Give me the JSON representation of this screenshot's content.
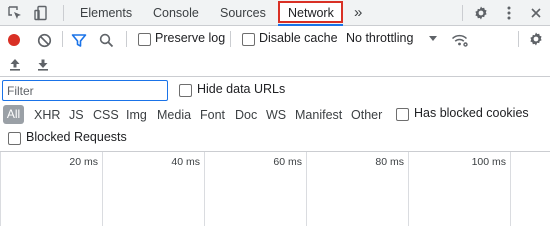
{
  "tabs": {
    "elements": "Elements",
    "console": "Console",
    "sources": "Sources",
    "network": "Network",
    "more": "»"
  },
  "toolbar": {
    "preserve_log": "Preserve log",
    "disable_cache": "Disable cache",
    "throttling": "No throttling"
  },
  "filter": {
    "value": "Filter",
    "hide_data_urls": "Hide data URLs"
  },
  "types": {
    "all": "All",
    "xhr": "XHR",
    "js": "JS",
    "css": "CSS",
    "img": "Img",
    "media": "Media",
    "font": "Font",
    "doc": "Doc",
    "ws": "WS",
    "manifest": "Manifest",
    "other": "Other",
    "has_blocked_cookies": "Has blocked cookies",
    "blocked_requests": "Blocked Requests"
  },
  "timeline": {
    "ticks": [
      "20 ms",
      "40 ms",
      "60 ms",
      "80 ms",
      "100 ms"
    ]
  },
  "colors": {
    "accent": "#1a73e8",
    "record": "#d93025",
    "active_tab_highlight": "#d93025"
  },
  "icons": {
    "inspect": "inspect-element-icon",
    "device": "device-toggle-icon",
    "settings": "gear-icon",
    "menu": "kebab-menu-icon",
    "close": "close-icon",
    "record": "record-icon",
    "clear": "clear-icon",
    "filter": "filter-funnel-icon",
    "search": "search-icon",
    "dropdown": "caret-down-icon",
    "network_conditions": "wifi-settings-icon",
    "import": "upload-icon",
    "export": "download-icon"
  }
}
